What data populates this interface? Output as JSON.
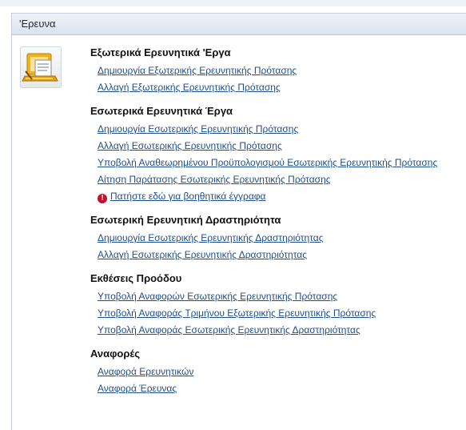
{
  "panel": {
    "title": "'Ερευνα"
  },
  "sections": [
    {
      "title": "Εξωτερικά Ερευνητικά 'Εργα",
      "links": [
        "Δημιουργία Εξωτερικής Ερευνητικής Πρότασης",
        "Αλλαγή Εξωτερικής Ερευνητικής Πρότασης"
      ]
    },
    {
      "title": "Εσωτερικά Ερευνητικά Έργα",
      "links": [
        "Δημιουργία Εσωτερικής Ερευνητικής Πρότασης",
        "Αλλαγή Εσωτερικής Ερευνητικής Πρότασης",
        "Υποβολή Αναθεωρημένου Προϋπολογισμού Εσωτερικής Ερευνητικής Πρότασης",
        "Αίτηση Παράτασης Εσωτερικής Ερευνητικής Πρότασης"
      ],
      "help": "Πατήστε εδώ για βοηθητικά έγγραφα"
    },
    {
      "title": "Εσωτερική Ερευνητική Δραστηριότητα",
      "links": [
        "Δημιουργία Εσωτερικής Ερευνητικής Δραστηριότητας",
        "Αλλαγή Εσωτερικής Ερευνητικής Δραστηριότητας"
      ]
    },
    {
      "title": "Εκθέσεις Προόδου",
      "links": [
        "Υποβολή Αναφορών Εσωτερικής Ερευνητικής Πρότασης",
        "Υποβολή Αναφοράς Τριμήνου Εξωτερικής Ερευνητικής Πρότασης",
        "Υποβολή Αναφοράς Εσωτερικής Ερευνητικής Δραστηριότητας"
      ]
    },
    {
      "title": "Αναφορές",
      "links": [
        "Αναφορά Ερευνητικών",
        "Αναφορά Έρευνας"
      ]
    }
  ],
  "colors": {
    "link": "#1f4e8c",
    "header_bg": "#dde6f0",
    "warning": "#c8102e"
  },
  "icons": {
    "section_icon": "laptop-document-icon",
    "help_icon": "warning-icon"
  }
}
